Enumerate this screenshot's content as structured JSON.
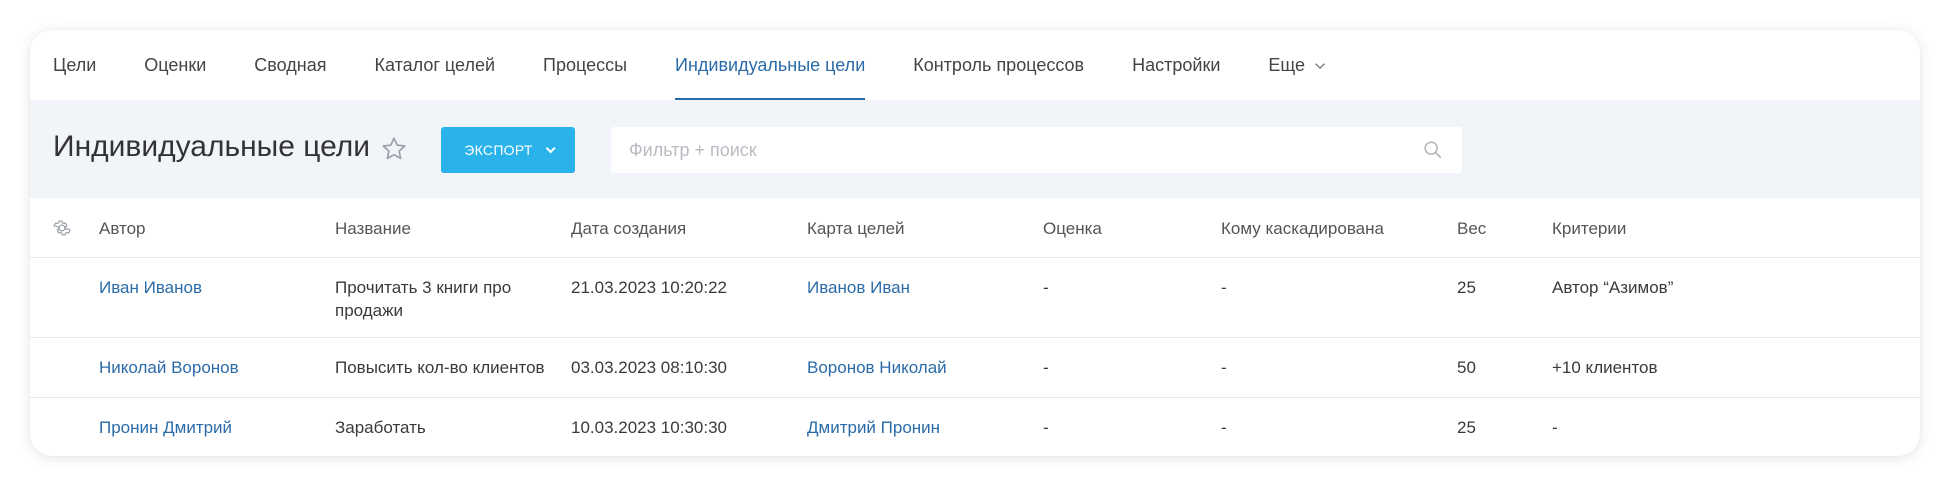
{
  "tabs": [
    {
      "label": "Цели",
      "active": false
    },
    {
      "label": "Оценки",
      "active": false
    },
    {
      "label": "Сводная",
      "active": false
    },
    {
      "label": "Каталог целей",
      "active": false
    },
    {
      "label": "Процессы",
      "active": false
    },
    {
      "label": "Индивидуальные цели",
      "active": true
    },
    {
      "label": "Контроль процессов",
      "active": false
    },
    {
      "label": "Настройки",
      "active": false
    },
    {
      "label": "Еще",
      "active": false,
      "icon": "chevron-down-icon"
    }
  ],
  "header": {
    "title": "Индивидуальные цели",
    "favorite_icon": "star-outline-icon",
    "export_label": "ЭКСПОРТ",
    "export_icon": "chevron-down-icon",
    "search_placeholder": "Фильтр + поиск",
    "search_value": "",
    "search_icon": "search-icon"
  },
  "table": {
    "settings_icon": "gear-icon",
    "columns": [
      "Автор",
      "Название",
      "Дата создания",
      "Карта целей",
      "Оценка",
      "Кому каскадирована",
      "Вес",
      "Критерии"
    ],
    "rows": [
      {
        "author": "Иван Иванов",
        "name": "Прочитать 3 книги про продажи",
        "date": "21.03.2023 10:20:22",
        "map": "Иванов Иван",
        "score": "-",
        "cascade": "-",
        "weight": "25",
        "criteria": "Автор “Азимов”"
      },
      {
        "author": "Николай Воронов",
        "name": "Повысить кол-во клиентов",
        "date": "03.03.2023 08:10:30",
        "map": "Воронов Николай",
        "score": "-",
        "cascade": "-",
        "weight": "50",
        "criteria": "+10 клиентов"
      },
      {
        "author": "Пронин Дмитрий",
        "name": "Заработать",
        "date": "10.03.2023 10:30:30",
        "map": "Дмитрий Пронин",
        "score": "-",
        "cascade": "-",
        "weight": "25",
        "criteria": "-"
      }
    ]
  },
  "colors": {
    "accent": "#2a6ba8",
    "export_button": "#2ab3ea",
    "band_background": "#f1f4f8",
    "divider": "#e3e6ea"
  }
}
